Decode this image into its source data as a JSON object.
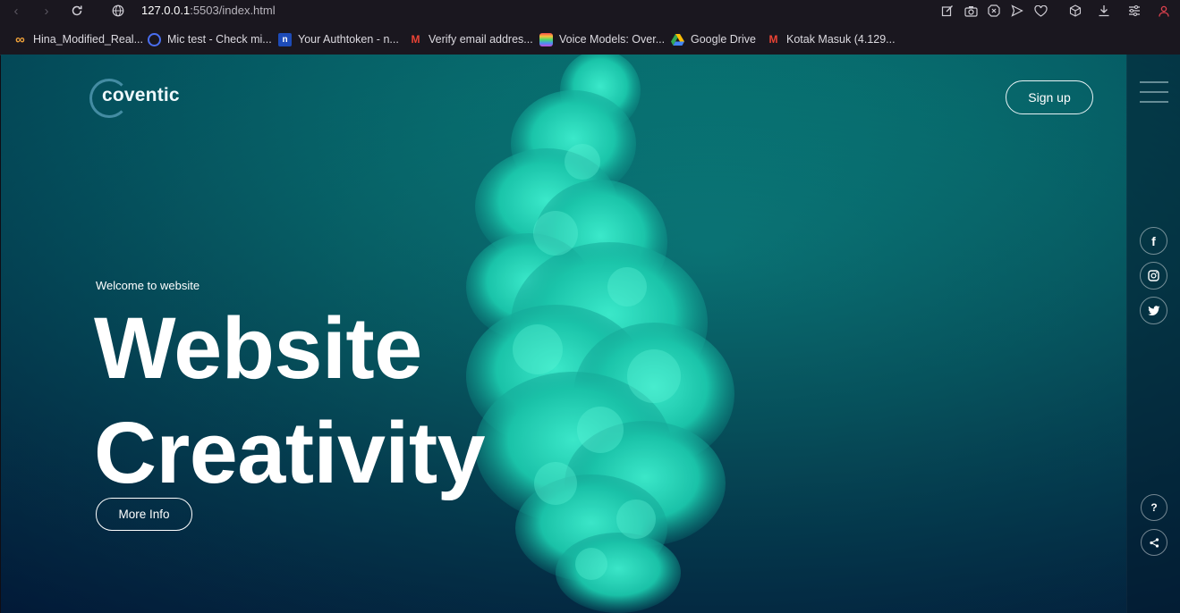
{
  "browser": {
    "url_host": "127.0.0.1",
    "url_rest": ":5503/index.html",
    "bookmarks": [
      {
        "label": "Hina_Modified_Real...",
        "icon": "infinity-icon",
        "color": "#f2a33a"
      },
      {
        "label": "Mic test - Check mi...",
        "icon": "mic-icon",
        "color": "#4a6ef0"
      },
      {
        "label": "Your Authtoken - n...",
        "icon": "ngrok-icon",
        "color": "#1d4bb8"
      },
      {
        "label": "Verify email addres...",
        "icon": "gmail-icon",
        "color": "#ea4335"
      },
      {
        "label": "Voice Models: Over...",
        "icon": "voice-icon",
        "color": "#c44ad8"
      },
      {
        "label": "Google Drive",
        "icon": "drive-icon",
        "color": "#34a853"
      },
      {
        "label": "Kotak Masuk (4.129...",
        "icon": "gmail-icon",
        "color": "#ea4335"
      }
    ]
  },
  "site": {
    "logo": "coventic",
    "signup_label": "Sign up",
    "welcome": "Welcome to website",
    "headline_line1": "Website",
    "headline_line2": "Creativity",
    "more_info_label": "More Info",
    "social": {
      "facebook": "f",
      "twitter": "t"
    },
    "help": "?"
  },
  "colors": {
    "accent": "#16d6b5",
    "background_dark": "#03203e"
  }
}
